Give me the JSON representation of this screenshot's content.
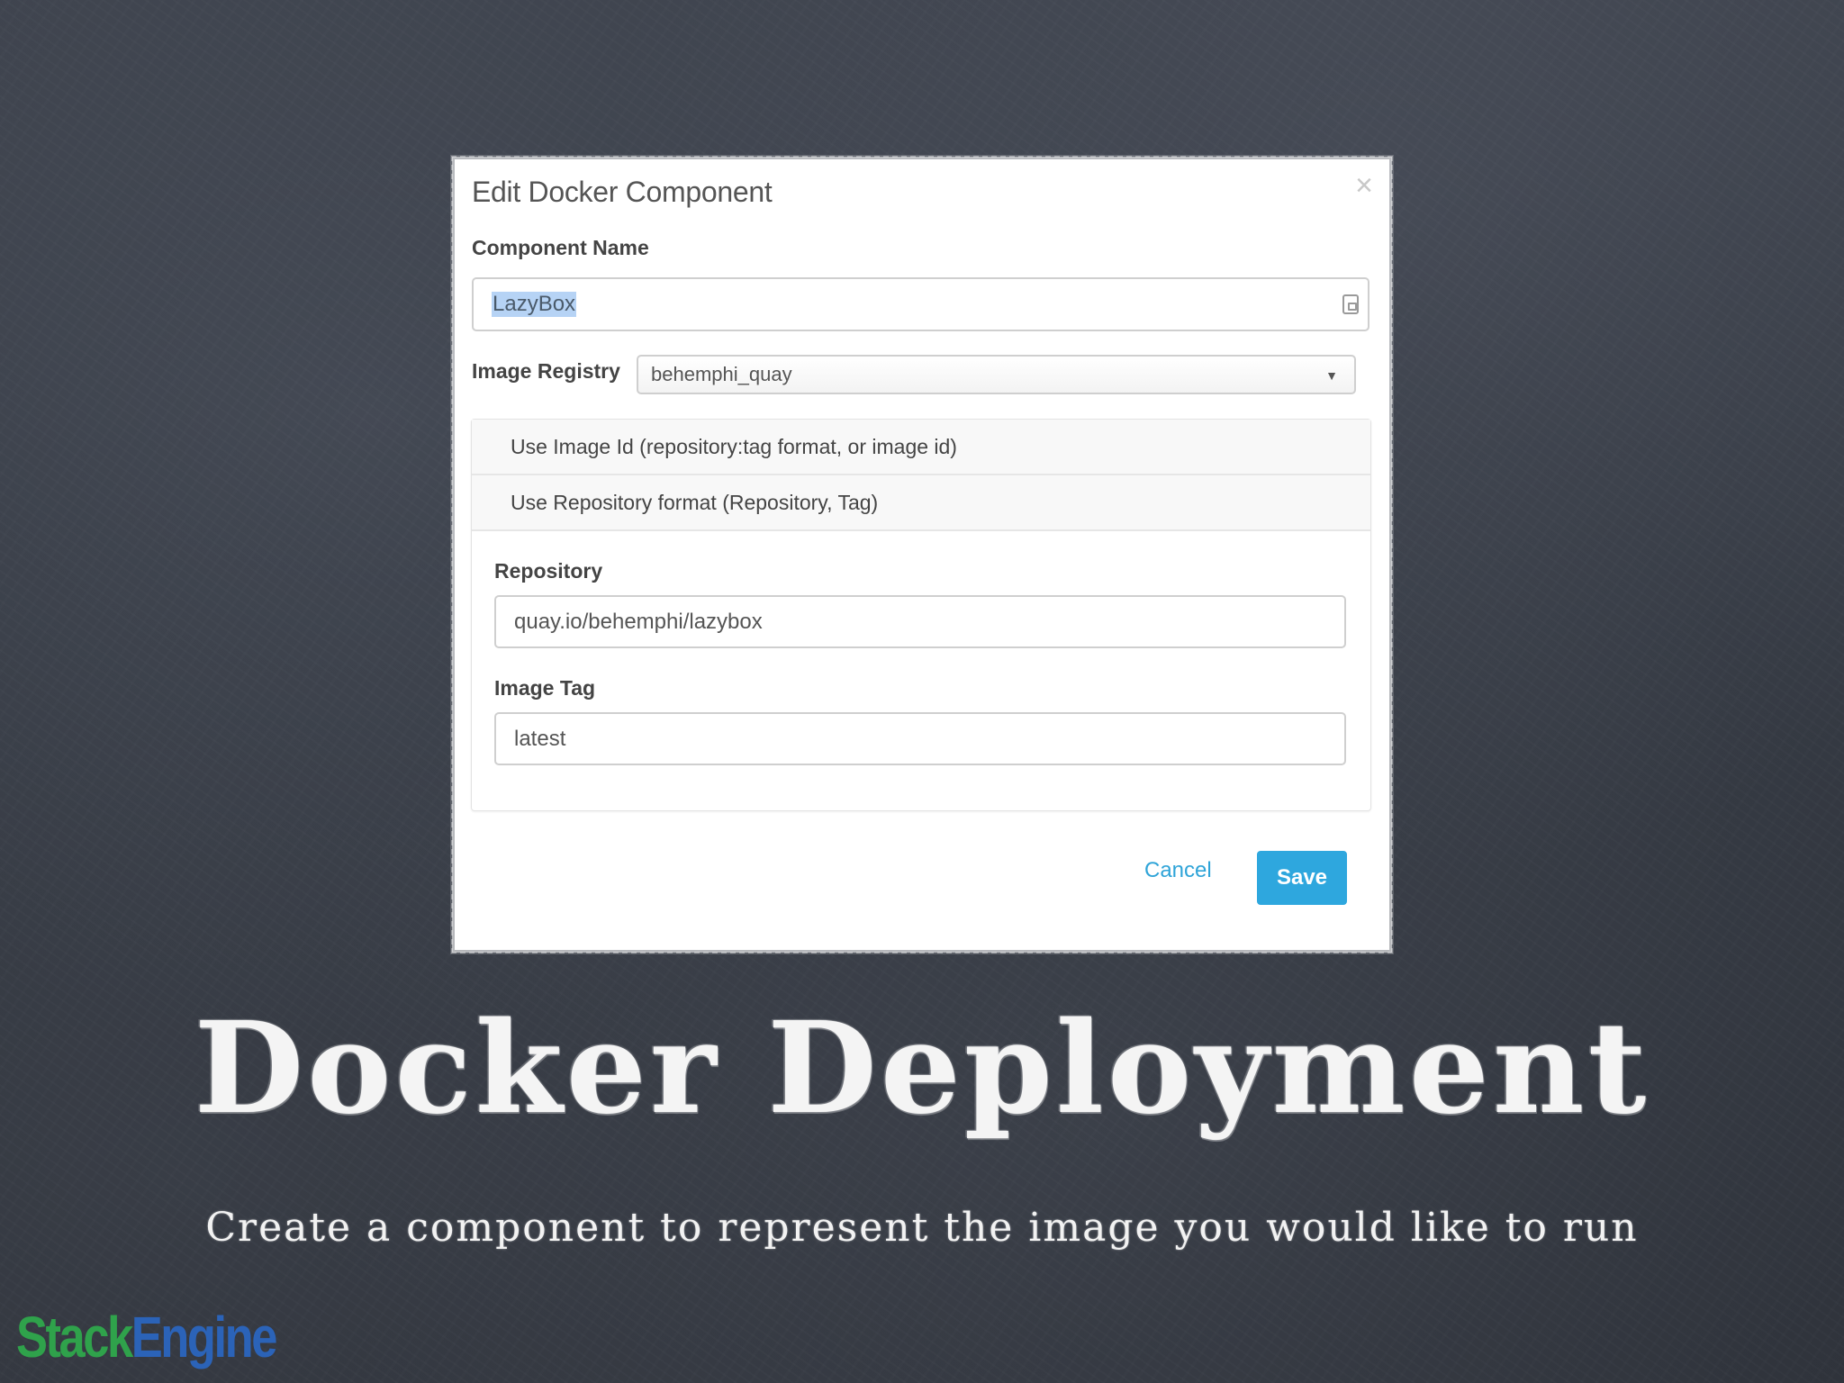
{
  "dialog": {
    "title": "Edit Docker Component",
    "close_symbol": "×",
    "component_name": {
      "label": "Component Name",
      "value": "LazyBox"
    },
    "image_registry": {
      "label": "Image Registry",
      "selected": "behemphi_quay"
    },
    "options": [
      {
        "label": "Use Image Id (repository:tag format, or image id)"
      },
      {
        "label": "Use Repository format (Repository, Tag)"
      }
    ],
    "repository": {
      "label": "Repository",
      "value": "quay.io/behemphi/lazybox"
    },
    "image_tag": {
      "label": "Image Tag",
      "value": "latest"
    },
    "cancel_label": "Cancel",
    "save_label": "Save"
  },
  "slide": {
    "title": "Docker Deployment",
    "subtitle": "Create a component to represent the image you would like to run"
  },
  "logo": {
    "part1": "Stack",
    "part2": "Engine"
  },
  "colors": {
    "accent": "#2ea7de",
    "logo_green": "#2fa24b",
    "logo_blue": "#2b63b8",
    "background": "#363a43"
  }
}
